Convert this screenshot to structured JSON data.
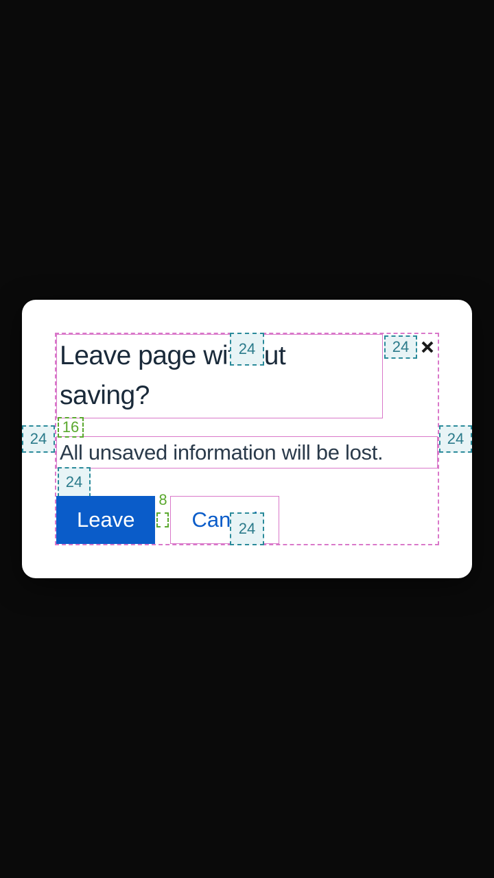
{
  "modal": {
    "title": "Leave page without saving?",
    "body": "All unsaved information will be lost.",
    "buttons": {
      "primary": "Leave",
      "secondary": "Cancel"
    }
  },
  "spacing": {
    "pad_top": "24",
    "pad_bottom": "24",
    "pad_left": "24",
    "pad_right": "24",
    "close_gap": "24",
    "title_body_margin": "16",
    "body_button_gap": "24",
    "button_gap": "8"
  }
}
